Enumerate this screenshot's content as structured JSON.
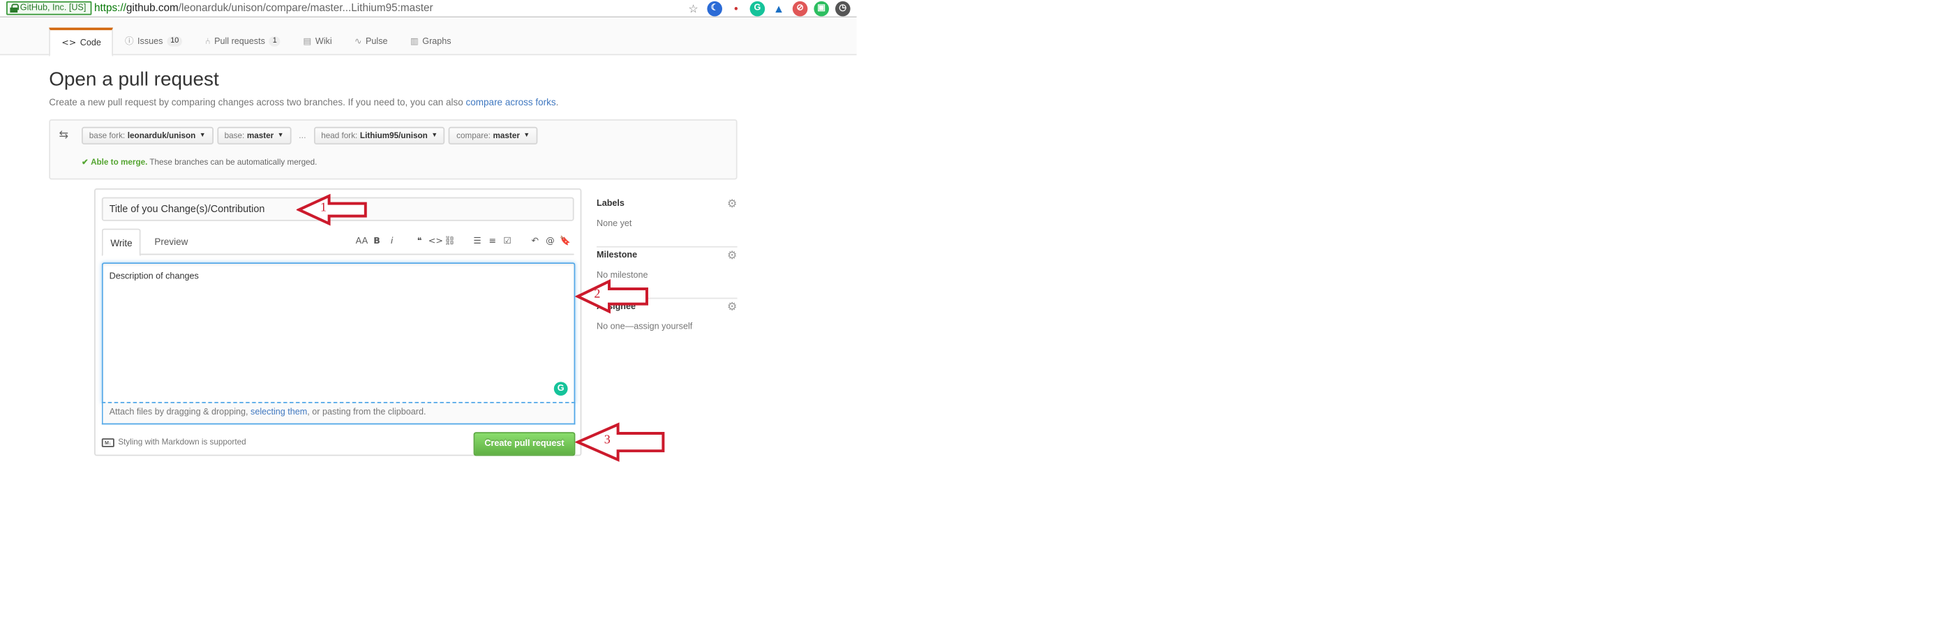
{
  "browser": {
    "secure_label": "GitHub, Inc. [US]",
    "url_scheme": "https://",
    "url_host": "github.com",
    "url_path": "/leonarduk/unison/compare/master...Lithium95:master",
    "extensions": [
      "star-icon",
      "moon-icon",
      "pin-icon",
      "grammarly-icon",
      "bell-icon",
      "block-icon",
      "evernote-icon",
      "clock-icon"
    ]
  },
  "repo_nav": {
    "tabs": [
      {
        "label": "Code",
        "icon": "code-icon"
      },
      {
        "label": "Issues",
        "count": "10",
        "icon": "issue-icon"
      },
      {
        "label": "Pull requests",
        "count": "1",
        "icon": "pr-icon"
      },
      {
        "label": "Wiki",
        "icon": "book-icon"
      },
      {
        "label": "Pulse",
        "icon": "pulse-icon"
      },
      {
        "label": "Graphs",
        "icon": "graph-icon"
      }
    ]
  },
  "header": {
    "title": "Open a pull request",
    "subtitle": "Create a new pull request by comparing changes across two branches. If you need to, you can also ",
    "subtitle_link": "compare across forks",
    "subtitle_end": "."
  },
  "range": {
    "base_fork_label": "base fork:",
    "base_fork": "leonarduk/unison",
    "base_label": "base:",
    "base": "master",
    "dots": "...",
    "head_fork_label": "head fork:",
    "head_fork": "Lithium95/unison",
    "compare_label": "compare:",
    "compare": "master",
    "merge_ok": "Able to merge.",
    "merge_msg": " These branches can be automatically merged."
  },
  "form": {
    "title_value": "Title of you Change(s)/Contribution",
    "write_tab": "Write",
    "preview_tab": "Preview",
    "comment_value": "Description of changes",
    "drag_text_1": "Attach files by dragging & dropping, ",
    "drag_link": "selecting them",
    "drag_text_2": ", or pasting from the clipboard.",
    "markdown_tip": "Styling with Markdown is supported",
    "submit_label": "Create pull request",
    "toolbar": [
      "AA",
      "B",
      "i",
      "❝",
      "<>",
      "⛓",
      "☰",
      "≡",
      "☑",
      "↶",
      "@",
      "🔖"
    ]
  },
  "sidebar": {
    "labels_head": "Labels",
    "labels_val": "None yet",
    "milestone_head": "Milestone",
    "milestone_val": "No milestone",
    "assignee_head": "Assignee",
    "assignee_val": "No one—assign yourself"
  },
  "annotations": [
    "1",
    "2",
    "3"
  ],
  "colors": {
    "arrow": "#cc1a2c",
    "accent_link": "#4078c0",
    "success": "#55a532",
    "button_green": "#60b044"
  }
}
